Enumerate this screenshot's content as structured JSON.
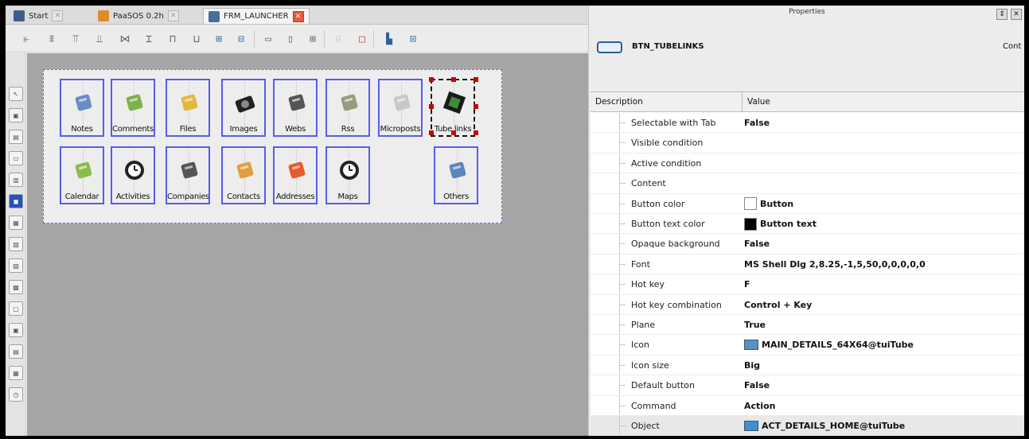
{
  "tabs": [
    {
      "label": "Start",
      "active": false
    },
    {
      "label": "PaaSOS 0.2h",
      "active": false
    },
    {
      "label": "FRM_LAUNCHER",
      "active": true
    }
  ],
  "toolbar_icons": [
    "align-left-icon",
    "align-center-h-icon",
    "align-top-icon",
    "align-bottom-icon",
    "space-h-icon",
    "space-v-icon",
    "same-width-icon",
    "same-height-icon",
    "center-h-icon",
    "center-v-icon",
    "hide-field-icon",
    "hide-label-icon",
    "grid-icon",
    "dotted-grid-icon",
    "frame-icon",
    "order-icon",
    "tab-order-icon"
  ],
  "vertical_tools": [
    "pointer-tool",
    "image-tool",
    "form-tool",
    "frame-tool",
    "group-tool",
    "button-tool",
    "edit-tool",
    "label-tool",
    "input-tool",
    "date-tool",
    "list-tool",
    "grid-tool",
    "tree-tool",
    "table-tool",
    "clock-tool"
  ],
  "launcher": {
    "row1": [
      {
        "label": "Notes",
        "icon": "notepad-icon",
        "color": "#6a8cc4"
      },
      {
        "label": "Comments",
        "icon": "comments-icon",
        "color": "#7cb24a"
      },
      {
        "label": "Files",
        "icon": "paperclip-icon",
        "color": "#e4b83c"
      },
      {
        "label": "Images",
        "icon": "camera-icon",
        "color": "#222222"
      },
      {
        "label": "Webs",
        "icon": "chain-link-icon",
        "color": "#555555"
      },
      {
        "label": "Rss",
        "icon": "rss-feed-icon",
        "color": "#9a9a80"
      },
      {
        "label": "Microposts",
        "icon": "cup-icon",
        "color": "#c8c8c8"
      },
      {
        "label": "Tube links",
        "icon": "film-strip-icon",
        "color": "#3e8c3a"
      }
    ],
    "row2": [
      {
        "label": "Calendar",
        "icon": "calendar-icon",
        "color": "#8bbd4a"
      },
      {
        "label": "Activities",
        "icon": "clock-icon",
        "color": "#222222"
      },
      {
        "label": "Companies",
        "icon": "briefcase-icon",
        "color": "#555555"
      },
      {
        "label": "Contacts",
        "icon": "contacts-icon",
        "color": "#e0a040"
      },
      {
        "label": "Addresses",
        "icon": "map-pin-icon",
        "color": "#e85a2c"
      },
      {
        "label": "Maps",
        "icon": "compass-icon",
        "color": "#222222"
      },
      {
        "label": "Others",
        "icon": "notebook-icon",
        "color": "#5a86bb"
      }
    ]
  },
  "properties": {
    "title": "Properties",
    "object_name": "BTN_TUBELINKS",
    "cont_label": "Cont",
    "headers": {
      "description": "Description",
      "value": "Value"
    },
    "rows": [
      {
        "desc": "Selectable with Tab",
        "value": "False"
      },
      {
        "desc": "Visible condition",
        "value": ""
      },
      {
        "desc": "Active condition",
        "value": ""
      },
      {
        "desc": "Content",
        "value": ""
      },
      {
        "desc": "Button color",
        "value": "Button",
        "swatch": "#ffffff"
      },
      {
        "desc": "Button text color",
        "value": "Button text",
        "swatch": "#000000"
      },
      {
        "desc": "Opaque background",
        "value": "False"
      },
      {
        "desc": "Font",
        "value": "MS Shell Dlg 2,8.25,-1,5,50,0,0,0,0,0"
      },
      {
        "desc": "Hot key",
        "value": "F"
      },
      {
        "desc": "Hot key combination",
        "value": "Control + Key"
      },
      {
        "desc": "Plane",
        "value": "True"
      },
      {
        "desc": "Icon",
        "value": "MAIN_DETAILS_64X64@tuiTube",
        "icon": true
      },
      {
        "desc": "Icon size",
        "value": "Big"
      },
      {
        "desc": "Default button",
        "value": "False"
      },
      {
        "desc": "Command",
        "value": "Action"
      },
      {
        "desc": "Object",
        "value": "ACT_DETAILS_HOME@tuiTube",
        "icon": true
      }
    ]
  }
}
